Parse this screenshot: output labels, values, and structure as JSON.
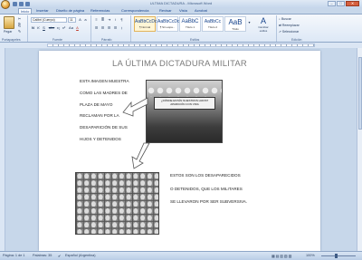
{
  "window": {
    "title": "ULTIMA DICTADURA - Microsoft Word",
    "minimize": "‒",
    "maximize": "□",
    "close": "✕"
  },
  "tabs": [
    "Inicio",
    "Insertar",
    "Diseño de página",
    "Referencias",
    "Correspondencia",
    "Revisar",
    "Vista",
    "Acrobat"
  ],
  "ribbon": {
    "paste_label": "Pegar",
    "font_name": "Calibri (Cuerpo)",
    "font_size": "11",
    "groups": [
      "Portapapeles",
      "Fuente",
      "Párrafo",
      "Estilos",
      "Edición"
    ],
    "font_buttons": [
      "N",
      "K",
      "S",
      "abc",
      "x₂",
      "x²",
      "Aa",
      "A"
    ],
    "styles": [
      {
        "sample": "AaBbCcDc",
        "name": "¶ Normal"
      },
      {
        "sample": "AaBbCcDc",
        "name": "¶ Sin espa..."
      },
      {
        "sample": "AaBbC",
        "name": "Título 1"
      },
      {
        "sample": "AaBbCc",
        "name": "Título 2"
      },
      {
        "sample": "AaB",
        "name": "Título"
      }
    ],
    "change_styles": "Cambiar estilos",
    "edit_items": [
      "Buscar",
      "Reemplazar",
      "Seleccionar"
    ]
  },
  "document": {
    "title": "LA ÚLTIMA DICTADURA MILITAR",
    "para1": [
      "ESTA IMAGEN MUESTRA",
      "COMO LAS MADRES DE",
      "PLAZA DE MAYO",
      "RECLAMAN POR LA",
      "DESAPARICIÓN DE SUS",
      "HIJOS  Y DETENIDOS"
    ],
    "para2": [
      "ESTOS SON LOS DESAPARECIDOS",
      "O DETENIDOS, QUE LOS MILITARES",
      "SE LLEVARON POR SER SUBVERSIVA."
    ],
    "banner_text": "¿DÓNDE ESTÁN NUESTROS HIJOS? APARICIÓN CON VIDA"
  },
  "status": {
    "page": "Página: 1 de 1",
    "words": "Palabras: 35",
    "language": "Español (Argentina)",
    "zoom": "100%"
  }
}
